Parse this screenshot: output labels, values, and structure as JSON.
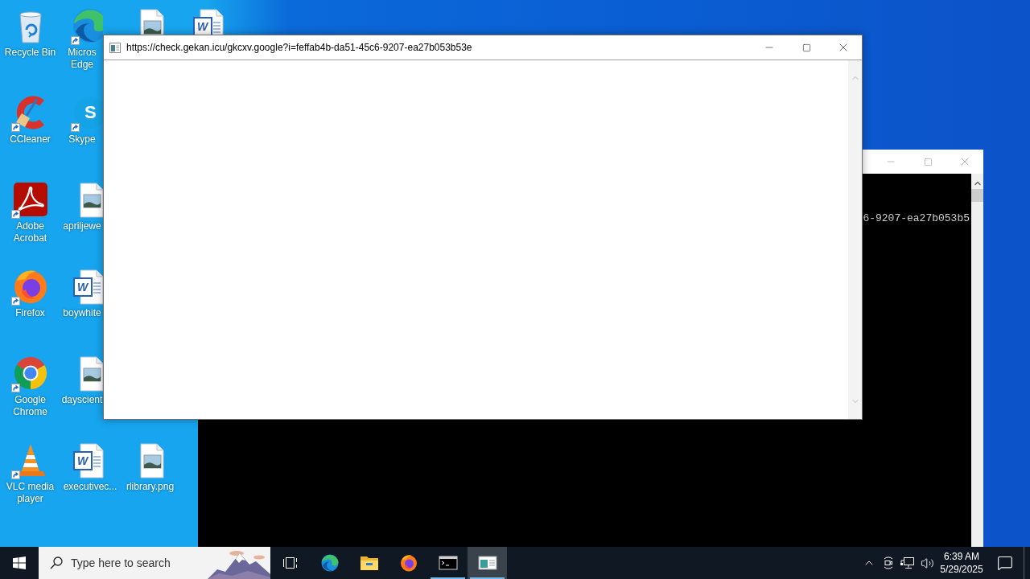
{
  "desktop_icons": [
    {
      "kind": "recycle-bin",
      "label": "Recycle Bin",
      "shortcut": false
    },
    {
      "kind": "ccleaner",
      "label": "CCleaner",
      "shortcut": true
    },
    {
      "kind": "acrobat",
      "label": "Adobe Acrobat",
      "shortcut": true
    },
    {
      "kind": "firefox",
      "label": "Firefox",
      "shortcut": true
    },
    {
      "kind": "chrome",
      "label": "Google Chrome",
      "shortcut": true
    },
    {
      "kind": "vlc",
      "label": "VLC media player",
      "shortcut": true
    },
    {
      "kind": "edge",
      "label": "Micros Edge",
      "shortcut": true
    },
    {
      "kind": "skype",
      "label": "Skype",
      "shortcut": true,
      "letter": "S"
    },
    {
      "kind": "image-file",
      "label": "apriljewe",
      "shortcut": false
    },
    {
      "kind": "word-file",
      "label": "boywhite",
      "shortcut": false,
      "letter": "W"
    },
    {
      "kind": "image-file",
      "label": "dayscient",
      "shortcut": false
    },
    {
      "kind": "word-file",
      "label": "executivec...",
      "shortcut": false,
      "letter": "W"
    },
    {
      "kind": "image-file",
      "shortcut": false
    },
    {
      "kind": "image-file",
      "label": "rlibrary.png",
      "shortcut": false
    },
    {
      "kind": "word-file",
      "shortcut": false,
      "letter": "W"
    }
  ],
  "console_window": {
    "output_line": "6-9207-ea27b053b5"
  },
  "popup_window": {
    "title": "https://check.gekan.icu/gkcxv.google?i=feffab4b-da51-45c6-9207-ea27b053b53e"
  },
  "taskbar": {
    "search": {
      "placeholder": "Type here to search"
    },
    "apps": [
      {
        "kind": "edge",
        "running": false,
        "selected": false
      },
      {
        "kind": "file-explorer",
        "running": false,
        "selected": false
      },
      {
        "kind": "firefox",
        "running": false,
        "selected": false
      },
      {
        "kind": "console",
        "running": true,
        "selected": false
      },
      {
        "kind": "window",
        "running": true,
        "selected": true
      }
    ],
    "clock": {
      "time": "6:39 AM",
      "date": "5/29/2025"
    }
  }
}
